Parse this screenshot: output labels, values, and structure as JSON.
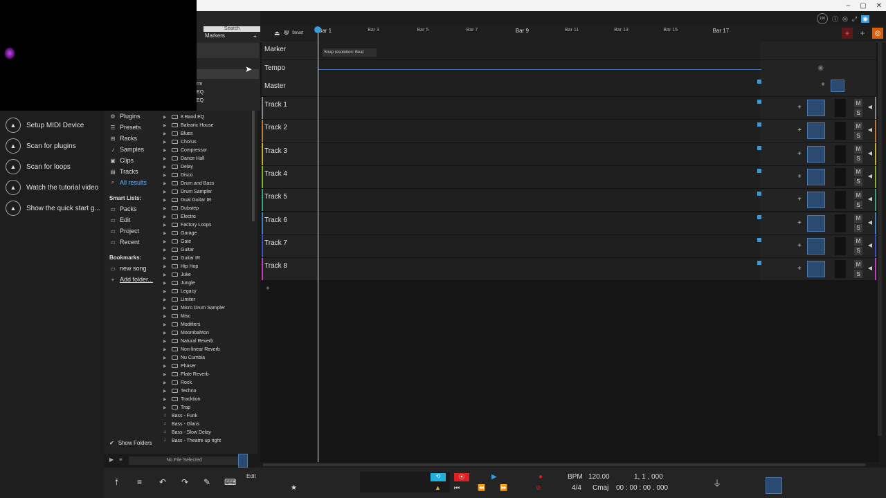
{
  "search": {
    "label": "Search",
    "markers_label": "Markers"
  },
  "toolbar": {
    "smart_label": "Smart",
    "zoom_label": "100"
  },
  "snap_tooltip": "Snap resolution: Beat",
  "ruler": {
    "bars_major": [
      "Bar 1",
      "Bar 9",
      "Bar 17"
    ],
    "bars_minor": [
      "Bar 3",
      "Bar 5",
      "Bar 7",
      "Bar 11",
      "Bar 13",
      "Bar 15"
    ]
  },
  "special_tracks": [
    "Marker",
    "Tempo",
    "Master"
  ],
  "tracks": [
    {
      "name": "Track 1",
      "color": "#888888"
    },
    {
      "name": "Track 2",
      "color": "#c07a3a"
    },
    {
      "name": "Track 3",
      "color": "#c0b040"
    },
    {
      "name": "Track 4",
      "color": "#80b040"
    },
    {
      "name": "Track 5",
      "color": "#40a080"
    },
    {
      "name": "Track 6",
      "color": "#4080c0"
    },
    {
      "name": "Track 7",
      "color": "#4050c0"
    },
    {
      "name": "Track 8",
      "color": "#c040c0"
    }
  ],
  "track_ctrl": {
    "mute": "M",
    "solo": "S"
  },
  "quick_start": [
    "Setup MIDI Device",
    "Scan for plugins",
    "Scan for loops",
    "Watch the tutorial video",
    "Show the quick start g..."
  ],
  "nav": {
    "items": [
      "Plugins",
      "Presets",
      "Racks",
      "Samples",
      "Clips",
      "Tracks",
      "All results"
    ],
    "smart_lists_title": "Smart Lists:",
    "smart_lists": [
      "Packs",
      "Edit",
      "Project",
      "Recent"
    ],
    "bookmarks_title": "Bookmarks:",
    "bookmarks": [
      "new song"
    ],
    "add_folder": "Add folder..."
  },
  "partial_list": [
    "rm",
    "EQ",
    "EQ"
  ],
  "folders": [
    "8 Band EQ",
    "Balearic House",
    "Blues",
    "Chorus",
    "Compressor",
    "Dance Hall",
    "Delay",
    "Disco",
    "Drum and Bass",
    "Drum Sampler",
    "Dual Guitar IR",
    "Dubstep",
    "Electro",
    "Factory Loops",
    "Garage",
    "Gate",
    "Guitar",
    "Guitar IR",
    "Hip Hop",
    "Juke",
    "Jungle",
    "Legacy",
    "Limiter",
    "Micro Drum Sampler",
    "Misc",
    "Modifiers",
    "Moombahton",
    "Natural Reverb",
    "Non-linear Reverb",
    "Nu Cumbia",
    "Phaser",
    "Plate Reverb",
    "Rock",
    "Techno",
    "Tracktion",
    "Trap"
  ],
  "presets": [
    "Bass - Funk",
    "Bass - Glans",
    "Bass - Slow Delay",
    "Bass - Theatre up right"
  ],
  "show_folders": "Show Folders",
  "no_file": "No File Selected",
  "transport": {
    "edit_label": "Edit",
    "bpm_label": "BPM",
    "bpm": "120.00",
    "position": "1, 1 , 000",
    "time_sig": "4/4",
    "key": "Cmaj",
    "time": "00 : 00 : 00 . 000"
  },
  "colors": {
    "accent": "#3a9ad9",
    "record": "#e02020",
    "loop": "#20b0e0"
  }
}
